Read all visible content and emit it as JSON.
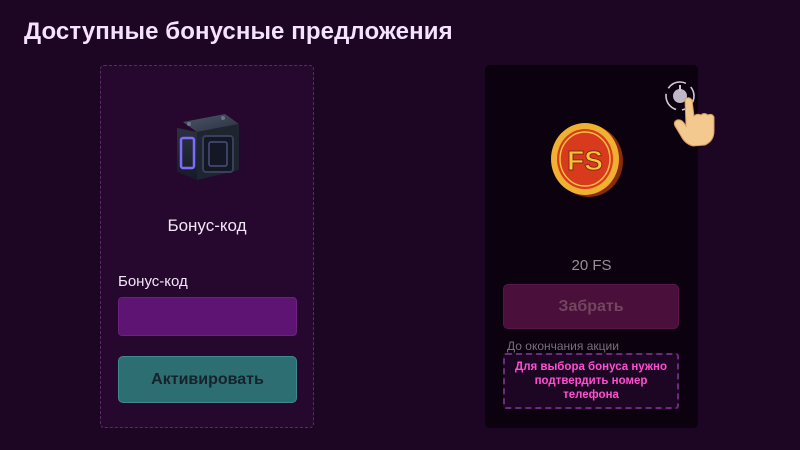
{
  "page": {
    "title": "Доступные бонусные предложения"
  },
  "bonus_code_card": {
    "icon": "mystery-box-icon",
    "title": "Бонус-код",
    "field_label": "Бонус-код",
    "input_value": "",
    "input_placeholder": "",
    "activate_label": "Активировать"
  },
  "free_spins_card": {
    "icon": "fs-coin-icon",
    "info_icon": "info-icon",
    "pointer_icon": "pointing-hand-icon",
    "amount": "20 FS",
    "claim_label": "Забрать",
    "until_label": "До окончания акции",
    "phone_note": "Для выбора бонуса нужно подтвердить номер телефона"
  },
  "colors": {
    "background": "#1c0623",
    "accent_pink": "#ff4fd0",
    "teal_button": "#2d6e72",
    "input_purple": "#5e1473"
  }
}
